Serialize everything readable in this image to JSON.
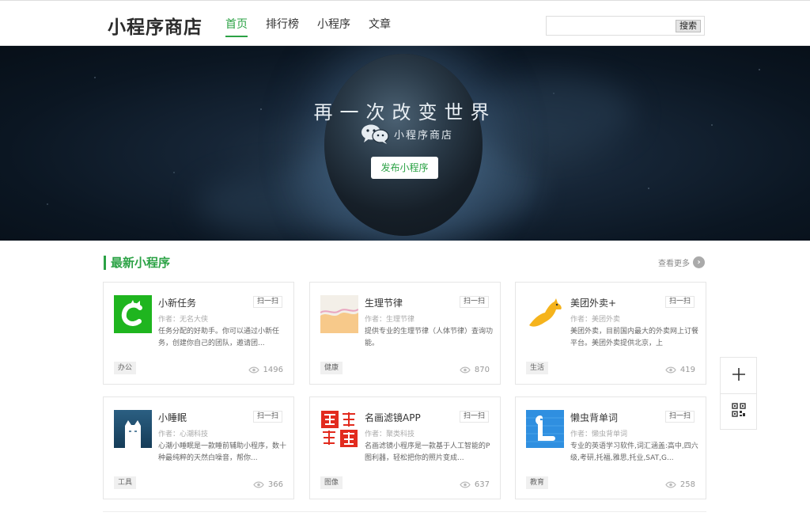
{
  "header": {
    "logo": "小程序商店",
    "nav": [
      {
        "label": "首页",
        "active": true
      },
      {
        "label": "排行榜",
        "active": false
      },
      {
        "label": "小程序",
        "active": false
      },
      {
        "label": "文章",
        "active": false
      }
    ],
    "search": {
      "placeholder": "",
      "button_label": "搜索"
    }
  },
  "banner": {
    "slogan": "再一次改变世界",
    "brand": "小程序商店",
    "publish_label": "发布小程序"
  },
  "section": {
    "title": "最新小程序",
    "more_label": "查看更多"
  },
  "cards": [
    {
      "name": "小新任务",
      "scan": "扫一扫",
      "author": "作者：无名大侠",
      "desc": "任务分配的好助手。你可以通过小新任务，创建你自己的团队，邀请团...",
      "tag": "办公",
      "views": "1496",
      "icon": "xiaoxin-icon"
    },
    {
      "name": "生理节律",
      "scan": "扫一扫",
      "author": "作者：生理节律",
      "desc": "提供专业的生理节律（人体节律）查询功能。",
      "tag": "健康",
      "views": "870",
      "icon": "biorhythm-icon"
    },
    {
      "name": "美团外卖+",
      "scan": "扫一扫",
      "author": "作者：美团外卖",
      "desc": "美团外卖，目前国内最大的外卖网上订餐平台。美团外卖提供北京，上",
      "tag": "生活",
      "views": "419",
      "icon": "meituan-kangaroo-icon"
    },
    {
      "name": "小睡眠",
      "scan": "扫一扫",
      "author": "作者：心潮科技",
      "desc": "心潮小睡眠是一款睡前辅助小程序，数十种最纯粹的天然白噪音，帮你...",
      "tag": "工具",
      "views": "366",
      "icon": "sleep-cat-icon"
    },
    {
      "name": "名画滤镜APP",
      "scan": "扫一扫",
      "author": "作者：聚类科技",
      "desc": "名画滤镜小程序是一款基于人工智能的P图利器，轻松把你的照片变成...",
      "tag": "图像",
      "views": "637",
      "icon": "painting-filter-icon"
    },
    {
      "name": "懒虫背单词",
      "scan": "扫一扫",
      "author": "作者：懒虫背单词",
      "desc": "专业的英语学习软件,词汇涵盖:高中,四六级,考研,托福,雅思,托业,SAT,G...",
      "tag": "教育",
      "views": "258",
      "icon": "lazyworm-icon"
    }
  ],
  "side_panel": [
    {
      "icon": "plus-icon"
    },
    {
      "icon": "qr-code-icon"
    }
  ],
  "colors": {
    "accent": "#2ba245",
    "border": "#e6e6e6"
  }
}
